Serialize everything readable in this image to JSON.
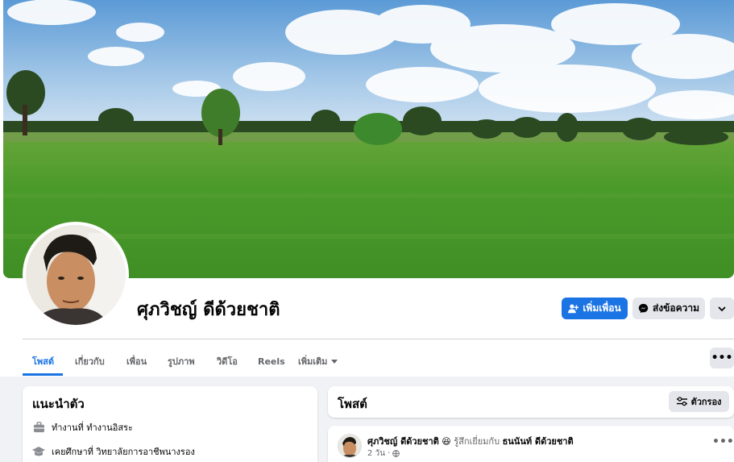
{
  "profile": {
    "name": "ศุภวิชญ์ ดีด้วยชาติ"
  },
  "actions": {
    "add_friend_label": "เพิ่มเพื่อน",
    "message_label": "ส่งข้อความ",
    "more_label": "⌄"
  },
  "tabs": [
    {
      "label": "โพสต์",
      "active": true
    },
    {
      "label": "เกี่ยวกับ"
    },
    {
      "label": "เพื่อน"
    },
    {
      "label": "รูปภาพ"
    },
    {
      "label": "วิดีโอ"
    },
    {
      "label": "Reels"
    },
    {
      "label": "เพิ่มเติม"
    }
  ],
  "tab_more_label": "•••",
  "intro": {
    "title": "แนะนำตัว",
    "items": [
      {
        "icon": "briefcase-icon",
        "text": "ทำงานที่ ทำงานอิสระ"
      },
      {
        "icon": "graduation-cap-icon",
        "text": "เคยศึกษาที่ วิทยาลัยการอาชีพนางรอง"
      }
    ]
  },
  "posts_header": {
    "title": "โพสต์",
    "filter_label": "ตัวกรอง"
  },
  "post": {
    "author": "ศุภวิชญ์ ดีด้วยชาติ",
    "emoji": "😆",
    "feeling": "รู้สึกเยี่ยมกับ",
    "tagged": "ธนนันท์ ดีด้วยชาติ",
    "time": "2 วัน ·",
    "more_label": "•••"
  },
  "colors": {
    "accent": "#1b74e4",
    "page_bg": "#f0f2f5",
    "button_gray": "#e4e6eb"
  }
}
